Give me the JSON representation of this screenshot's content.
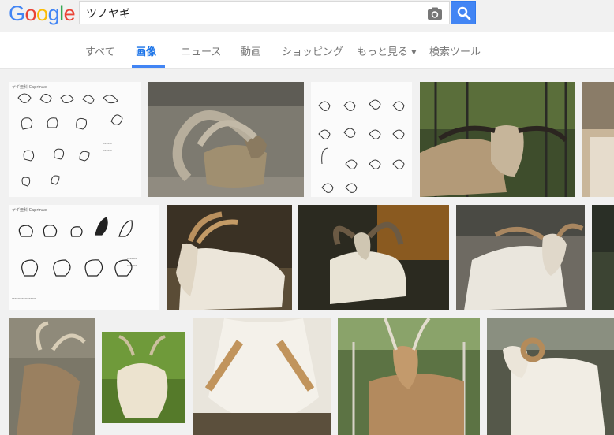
{
  "logo": {
    "text": "Google",
    "letters": [
      {
        "ch": "G",
        "color": "#4285f4"
      },
      {
        "ch": "o",
        "color": "#ea4335"
      },
      {
        "ch": "o",
        "color": "#fbbc05"
      },
      {
        "ch": "g",
        "color": "#4285f4"
      },
      {
        "ch": "l",
        "color": "#34a853"
      },
      {
        "ch": "e",
        "color": "#ea4335"
      }
    ]
  },
  "search": {
    "query": "ツノヤギ",
    "camera_icon": "camera-icon",
    "button_icon": "search-icon"
  },
  "tabs": [
    {
      "label": "すべて",
      "active": false
    },
    {
      "label": "画像",
      "active": true
    },
    {
      "label": "ニュース",
      "active": false
    },
    {
      "label": "動画",
      "active": false
    },
    {
      "label": "ショッピング",
      "active": false
    },
    {
      "label": "もっと見る ▾",
      "active": false
    },
    {
      "label": "検索ツール",
      "active": false
    }
  ],
  "colors": {
    "accent": "#4285f4",
    "active_tab": "#1a73e8",
    "inactive_tab": "#777777",
    "page_bg": "#f1f1f1"
  },
  "results": [
    {
      "kind": "sketch",
      "desc": "goat-species-sketches"
    },
    {
      "kind": "photo",
      "desc": "markhor-spiral-horns"
    },
    {
      "kind": "sketch",
      "desc": "goat-horn-sketches"
    },
    {
      "kind": "photo",
      "desc": "long-horned-goat-in-pen"
    },
    {
      "kind": "photo",
      "desc": "partial-image"
    },
    {
      "kind": "sketch",
      "desc": "horn-types-chart"
    },
    {
      "kind": "photo",
      "desc": "white-goat-curved-horns"
    },
    {
      "kind": "photo",
      "desc": "markhor-dark-background"
    },
    {
      "kind": "photo",
      "desc": "white-goat-near-wall"
    },
    {
      "kind": "photo",
      "desc": "partial-image"
    },
    {
      "kind": "photo",
      "desc": "goat-on-rocks"
    },
    {
      "kind": "photo",
      "desc": "goat-in-grass"
    },
    {
      "kind": "photo",
      "desc": "goat-horns-overhead"
    },
    {
      "kind": "photo",
      "desc": "tan-goat-by-fence"
    },
    {
      "kind": "photo",
      "desc": "white-ram-curled-horns"
    }
  ]
}
